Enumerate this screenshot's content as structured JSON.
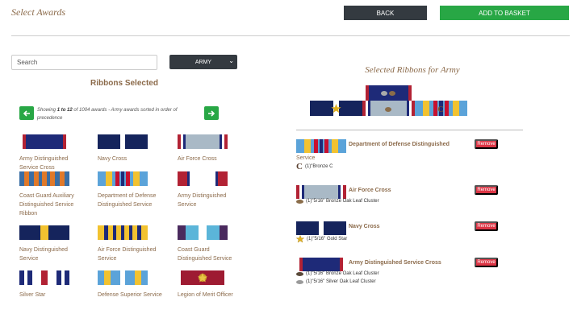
{
  "header": {
    "title": "Select Awards",
    "back_label": "BACK",
    "basket_label": "ADD TO BASKET"
  },
  "search": {
    "placeholder": "Search"
  },
  "branch": {
    "selected": "ARMY"
  },
  "left": {
    "title": "Ribbons Selected",
    "showing_prefix": "Showing ",
    "showing_range": "1 to 12",
    "showing_rest": " of 1004 awards - Army awards sorted in order of precedence"
  },
  "ribbons": [
    {
      "name": "Army Distinguished Service Cross"
    },
    {
      "name": "Navy Cross"
    },
    {
      "name": "Air Force Cross"
    },
    {
      "name": "Coast Guard Auxiliary Distinguished Service Ribbon"
    },
    {
      "name": "Department of Defense Distinguished Service"
    },
    {
      "name": "Army Distinguished Service"
    },
    {
      "name": "Navy Distinguished Service"
    },
    {
      "name": "Air Force Distinguished Service"
    },
    {
      "name": "Coast Guard Distinguished Service"
    },
    {
      "name": "Silver Star"
    },
    {
      "name": "Defense Superior Service"
    },
    {
      "name": "Legion of Merit Officer"
    }
  ],
  "right": {
    "title": "Selected Ribbons for Army",
    "remove_label": "Remove"
  },
  "selected": [
    {
      "name": "Department of Defense Distinguished",
      "name_wrap": "Service",
      "devices": [
        "(1)\"Bronze C"
      ]
    },
    {
      "name": "Air Force Cross",
      "devices": [
        "(1)\"5/16\" Bronze Oak Leaf Cluster"
      ]
    },
    {
      "name": "Navy Cross",
      "devices": [
        "(1)\"5/16\" Gold Star"
      ]
    },
    {
      "name": "Army Distinguished Service Cross",
      "devices": [
        "(1)\"5/16\" Bronze Oak Leaf Cluster",
        "(1)\"5/16\" Silver Oak Leaf Cluster"
      ]
    }
  ],
  "colors": {
    "accent_green": "#28a745",
    "dark": "#343a40",
    "danger": "#dc3545",
    "label_brown": "#8b6a4a"
  }
}
